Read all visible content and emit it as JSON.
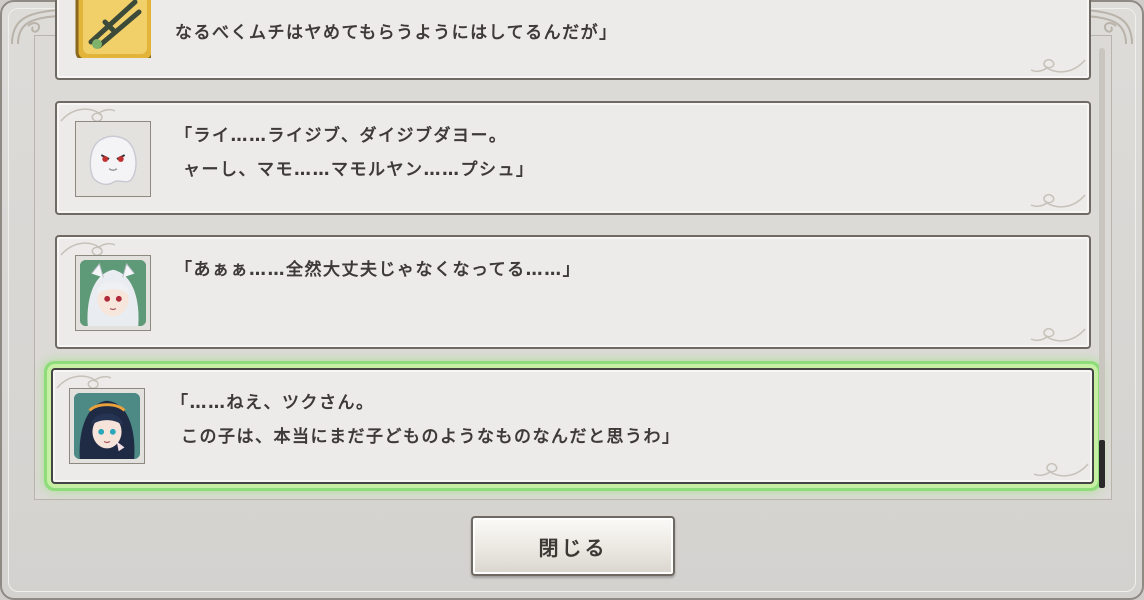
{
  "log": {
    "entries": [
      {
        "speaker_icon": "gold-item-icon",
        "line1": "",
        "line2": "なるべくムチはヤめてもらうようにはしてるんだが」"
      },
      {
        "speaker_icon": "ghost-creature-portrait",
        "line1": "「ライ……ライジブ、ダイジブダヨー。",
        "line2": "ャーし、マモ……マモルヤン……プシュ」"
      },
      {
        "speaker_icon": "white-haired-girl-portrait",
        "line1": "「あぁぁ……全然大丈夫じゃなくなってる……」",
        "line2": ""
      },
      {
        "speaker_icon": "dark-haired-girl-portrait",
        "line1": "「……ねえ、ツクさん。",
        "line2": "この子は、本当にまだ子どものようなものなんだと思うわ」"
      }
    ],
    "selected_index": 3
  },
  "buttons": {
    "close_label": "閉じる"
  },
  "colors": {
    "highlight": "#8fdc7a",
    "panel": "#ecebe9",
    "frame": "#d4d2cf"
  }
}
